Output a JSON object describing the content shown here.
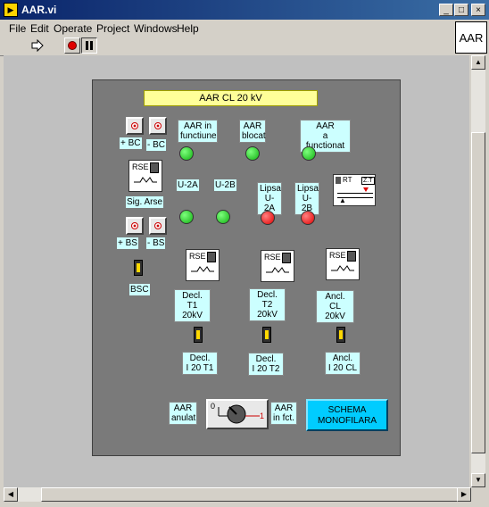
{
  "window": {
    "title": "AAR.vi",
    "min_label": "_",
    "max_label": "□",
    "close_label": "×"
  },
  "menu": {
    "file": "File",
    "edit": "Edit",
    "operate": "Operate",
    "project": "Project",
    "windows": "Windows",
    "help": "Help"
  },
  "toolbar": {
    "run_icon": "run-arrow-icon",
    "stop_icon": "stop-icon",
    "pause_icon": "pause-icon",
    "vi_icon_label": "AAR"
  },
  "panel": {
    "header": "AAR  CL 20 kV",
    "bc_plus": "+ BC",
    "bc_minus": "- BC",
    "sig_arse": "Sig. Arse",
    "bs_plus": "+ BS",
    "bs_minus": "- BS",
    "bsc": "BSC",
    "rse_label": "RSE 3",
    "aar_in_functiune_1": "AAR in",
    "aar_in_functiune_2": "functiune",
    "aar_blocat_1": "AAR",
    "aar_blocat_2": "blocat",
    "aar_a_functionat_1": "AAR",
    "aar_a_functionat_2": "a functionat",
    "u2a": "U-2A",
    "u2b": "U-2B",
    "lipsa_u2a_1": "Lipsa",
    "lipsa_u2a_2": "U-2A",
    "lipsa_u2b_1": "Lipsa",
    "lipsa_u2b_2": "U-2B",
    "rt_label": "RT",
    "zt_label": "Z.T",
    "decl_t1_1": "Decl. T1",
    "decl_t1_2": "20kV",
    "decl_t2_1": "Decl. T2",
    "decl_t2_2": "20kV",
    "ancl_cl_1": "Ancl. CL",
    "ancl_cl_2": "20kV",
    "decl_i20_t1_1": "Decl.",
    "decl_i20_t1_2": "I 20  T1",
    "decl_i20_t2_1": "Decl.",
    "decl_i20_t2_2": "I 20  T2",
    "ancl_i20_cl_1": "Ancl.",
    "ancl_i20_cl_2": "I 20  CL",
    "aar_anulat_1": "AAR",
    "aar_anulat_2": "anulat",
    "aar_in_fct_1": "AAR",
    "aar_in_fct_2": "in fct.",
    "toggle_off": "0",
    "toggle_on": "1",
    "schema_1": "SCHEMA",
    "schema_2": "MONOFILARA"
  },
  "colors": {
    "titlebar": "#0a246a",
    "panel": "#7a7a7a",
    "label_bg": "#ccffff",
    "header_bg": "#ffff99",
    "led_green": "#12b012",
    "led_red": "#e00000",
    "schema_btn": "#00ccff"
  }
}
